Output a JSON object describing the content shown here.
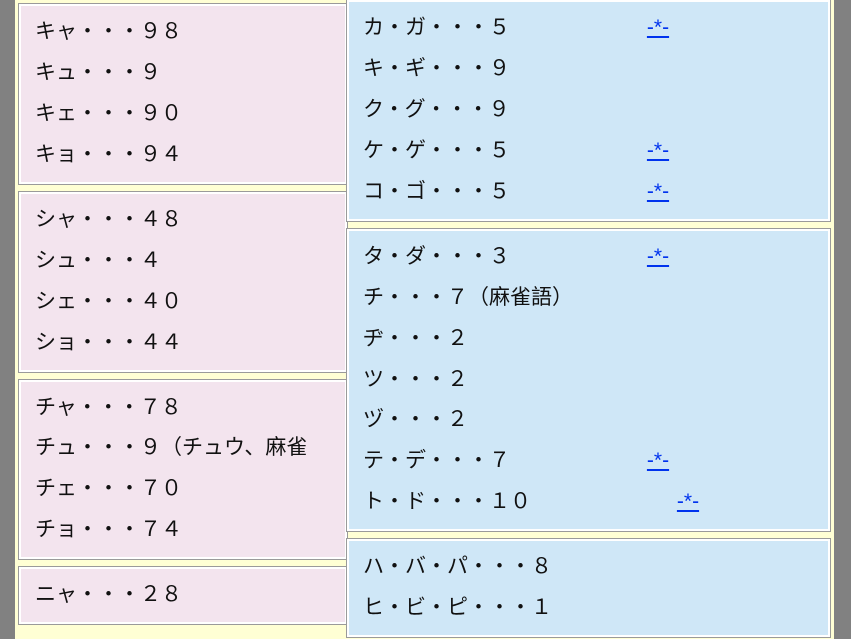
{
  "left_groups": [
    {
      "rows": [
        {
          "text": "キャ・・・９８"
        },
        {
          "text": "キュ・・・９"
        },
        {
          "text": "キェ・・・９０"
        },
        {
          "text": "キョ・・・９４"
        }
      ]
    },
    {
      "rows": [
        {
          "text": "シャ・・・４８"
        },
        {
          "text": "シュ・・・４"
        },
        {
          "text": "シェ・・・４０"
        },
        {
          "text": "ショ・・・４４"
        }
      ]
    },
    {
      "rows": [
        {
          "text": "チャ・・・７８"
        },
        {
          "text": "チュ・・・９（チュウ、麻雀"
        },
        {
          "text": "チェ・・・７０"
        },
        {
          "text": "チョ・・・７４"
        }
      ]
    },
    {
      "rows": [
        {
          "text": "ニャ・・・２８"
        }
      ]
    }
  ],
  "right_groups": [
    {
      "rows": [
        {
          "text": "カ・ガ・・・５",
          "link": "-*-"
        },
        {
          "text": "キ・ギ・・・９"
        },
        {
          "text": "ク・グ・・・９"
        },
        {
          "text": "ケ・ゲ・・・５",
          "link": "-*-"
        },
        {
          "text": "コ・ゴ・・・５",
          "link": "-*-"
        }
      ]
    },
    {
      "rows": [
        {
          "text": "タ・ダ・・・３",
          "link": "-*-"
        },
        {
          "text": "チ・・・７（麻雀語）"
        },
        {
          "text": "ヂ・・・２"
        },
        {
          "text": "ツ・・・２"
        },
        {
          "text": "ヅ・・・２"
        },
        {
          "text": "テ・デ・・・７",
          "link": "-*-"
        },
        {
          "text": "ト・ド・・・１０",
          "link": "-*-",
          "linkShift": true
        }
      ]
    },
    {
      "rows": [
        {
          "text": "ハ・バ・パ・・・８"
        },
        {
          "text": "ヒ・ビ・ピ・・・１"
        }
      ]
    }
  ]
}
